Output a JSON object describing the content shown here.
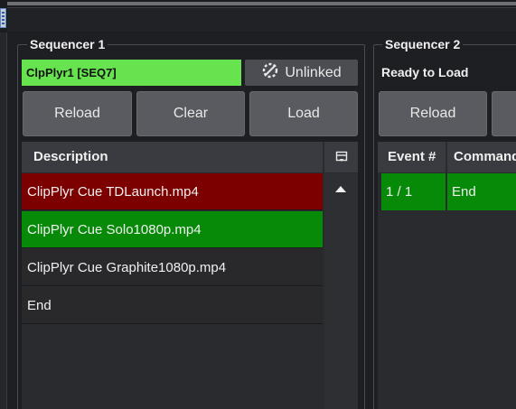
{
  "sequencer1": {
    "title": "Sequencer 1",
    "status_text": "ClpPlyr1 [SEQ7]",
    "link_button_label": "Unlinked",
    "buttons": {
      "reload": "Reload",
      "clear": "Clear",
      "load": "Load"
    },
    "list": {
      "column_header": "Description",
      "rows": [
        {
          "text": "ClipPlyr Cue TDLaunch.mp4",
          "state": "red"
        },
        {
          "text": "ClipPlyr Cue Solo1080p.mp4",
          "state": "green"
        },
        {
          "text": "ClipPlyr Cue Graphite1080p.mp4",
          "state": "plain"
        },
        {
          "text": "End",
          "state": "plain"
        }
      ]
    }
  },
  "sequencer2": {
    "title": "Sequencer 2",
    "status_text": "Ready to Load",
    "buttons": {
      "reload": "Reload"
    },
    "table": {
      "columns": [
        "Event #",
        "Command"
      ],
      "rows": [
        {
          "event": "1 / 1",
          "command": "End"
        }
      ]
    }
  },
  "colors": {
    "active_green": "#66e34f",
    "row_red": "#7d0000",
    "row_green": "#078a07"
  }
}
